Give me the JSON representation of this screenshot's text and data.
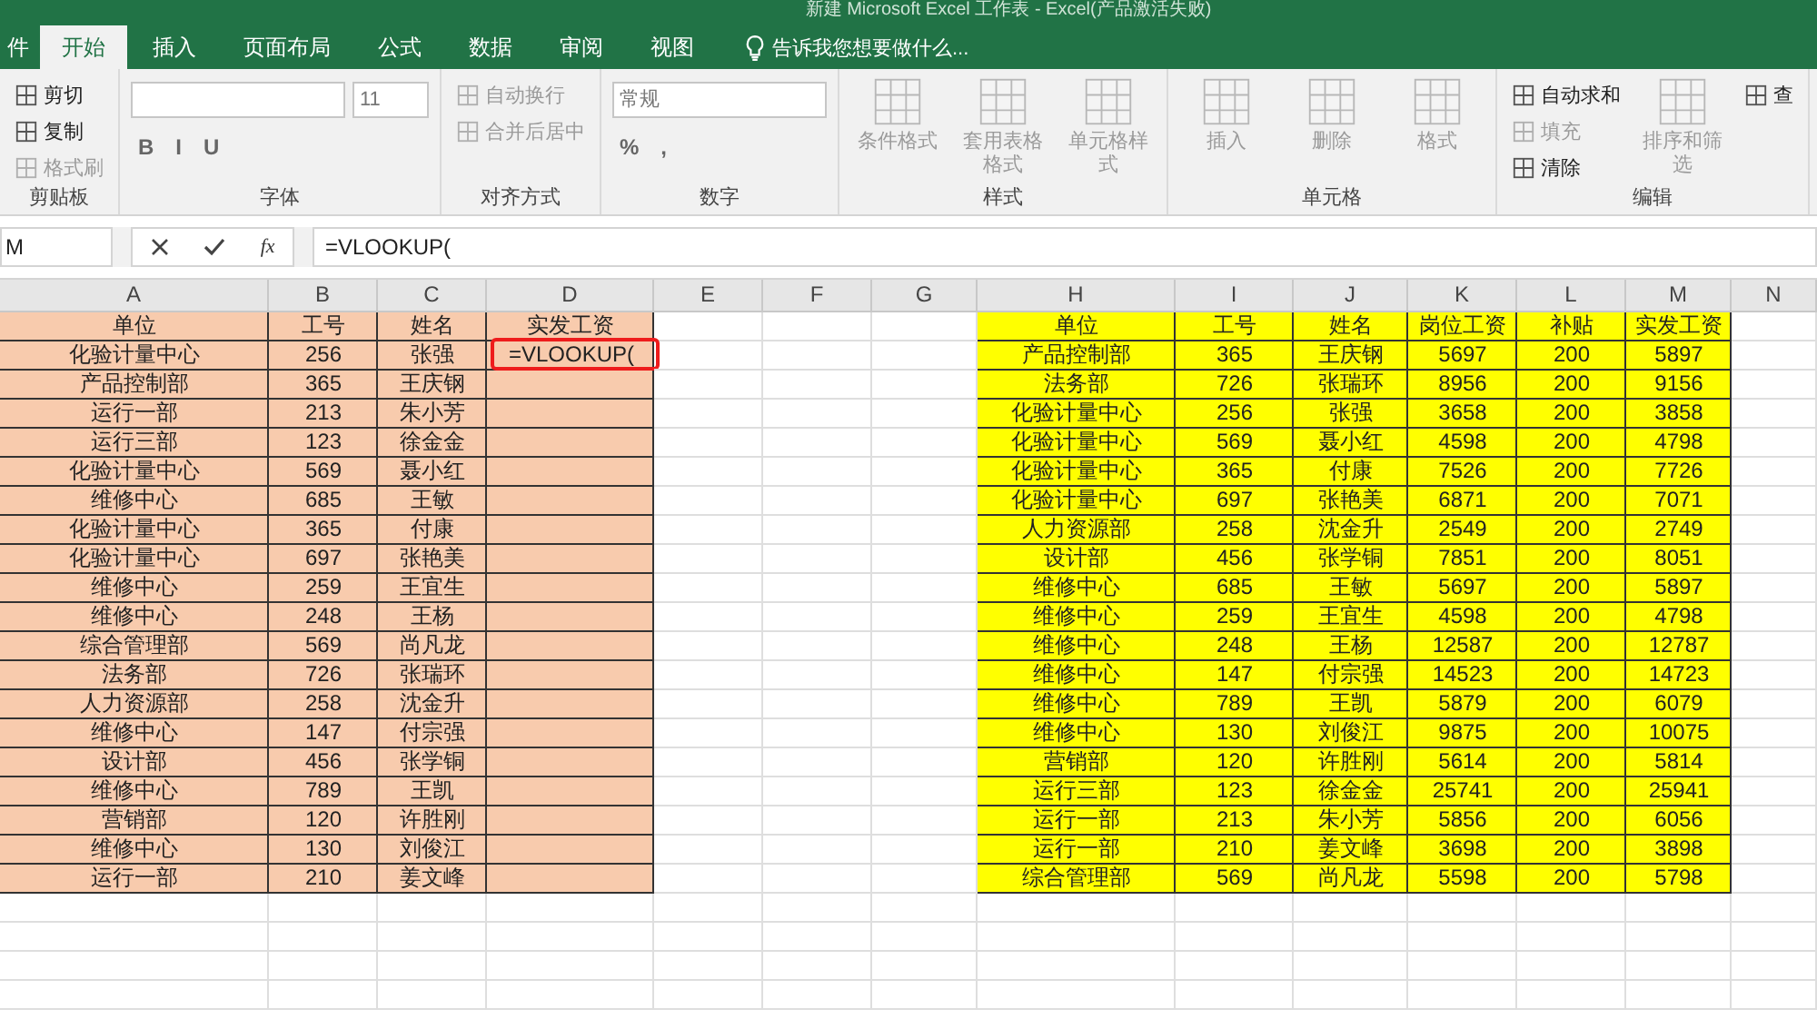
{
  "title_bar": {
    "title": "新建 Microsoft Excel 工作表 - Excel(产品激活失败)"
  },
  "ribbon_tabs": [
    {
      "label": "件",
      "selected": false
    },
    {
      "label": "开始",
      "selected": true
    },
    {
      "label": "插入",
      "selected": false
    },
    {
      "label": "页面布局",
      "selected": false
    },
    {
      "label": "公式",
      "selected": false
    },
    {
      "label": "数据",
      "selected": false
    },
    {
      "label": "审阅",
      "selected": false
    },
    {
      "label": "视图",
      "selected": false
    }
  ],
  "tell_me": "告诉我您想要做什么...",
  "ribbon_groups": [
    {
      "label": "剪贴板",
      "items": [
        {
          "kind": "small",
          "label": "剪切",
          "disabled": false
        },
        {
          "kind": "small",
          "label": "复制",
          "disabled": false
        },
        {
          "kind": "small",
          "label": "格式刷",
          "disabled": true
        }
      ]
    },
    {
      "label": "字体",
      "items": [
        {
          "kind": "field-row",
          "fields": [
            {
              "kind": "wide"
            },
            {
              "kind": "narrow",
              "value": "11"
            }
          ]
        },
        {
          "kind": "toggle-row",
          "labels": [
            "B",
            "I",
            "U"
          ]
        }
      ]
    },
    {
      "label": "对齐方式",
      "items": [
        {
          "kind": "small",
          "label": "自动换行",
          "disabled": true
        },
        {
          "kind": "small",
          "label": "合并后居中",
          "disabled": true
        }
      ]
    },
    {
      "label": "数字",
      "items": [
        {
          "kind": "field-row",
          "fields": [
            {
              "kind": "wide",
              "value": "常规"
            }
          ]
        },
        {
          "kind": "toggle-row",
          "labels": [
            "%",
            ","
          ]
        }
      ]
    },
    {
      "label": "样式",
      "items": [
        {
          "kind": "large",
          "label": "条件格式",
          "disabled": true
        },
        {
          "kind": "large",
          "label": "套用表格格式",
          "disabled": true
        },
        {
          "kind": "large",
          "label": "单元格样式",
          "disabled": true
        }
      ]
    },
    {
      "label": "单元格",
      "items": [
        {
          "kind": "large",
          "label": "插入",
          "disabled": true
        },
        {
          "kind": "large",
          "label": "删除",
          "disabled": true
        },
        {
          "kind": "large",
          "label": "格式",
          "disabled": true
        }
      ]
    },
    {
      "label": "编辑",
      "items": [
        {
          "kind": "small",
          "label": "自动求和",
          "disabled": false
        },
        {
          "kind": "small",
          "label": "填充",
          "disabled": true
        },
        {
          "kind": "small",
          "label": "清除",
          "disabled": false
        },
        {
          "kind": "large",
          "label": "排序和筛选",
          "disabled": true
        },
        {
          "kind": "small",
          "label": "查",
          "disabled": false
        }
      ]
    }
  ],
  "name_box": "M",
  "fx_label": "fx",
  "formula": "=VLOOKUP(",
  "columns": [
    "A",
    "B",
    "C",
    "D",
    "E",
    "F",
    "G",
    "H",
    "I",
    "J",
    "K",
    "L",
    "M",
    "N"
  ],
  "left_table": {
    "header": [
      "单位",
      "工号",
      "姓名",
      "实发工资"
    ],
    "rows": [
      [
        "化验计量中心",
        "256",
        "张强"
      ],
      [
        "产品控制部",
        "365",
        "王庆钢"
      ],
      [
        "运行一部",
        "213",
        "朱小芳"
      ],
      [
        "运行三部",
        "123",
        "徐金金"
      ],
      [
        "化验计量中心",
        "569",
        "聂小红"
      ],
      [
        "维修中心",
        "685",
        "王敏"
      ],
      [
        "化验计量中心",
        "365",
        "付康"
      ],
      [
        "化验计量中心",
        "697",
        "张艳美"
      ],
      [
        "维修中心",
        "259",
        "王宜生"
      ],
      [
        "维修中心",
        "248",
        "王杨"
      ],
      [
        "综合管理部",
        "569",
        "尚凡龙"
      ],
      [
        "法务部",
        "726",
        "张瑞环"
      ],
      [
        "人力资源部",
        "258",
        "沈金升"
      ],
      [
        "维修中心",
        "147",
        "付宗强"
      ],
      [
        "设计部",
        "456",
        "张学铜"
      ],
      [
        "维修中心",
        "789",
        "王凯"
      ],
      [
        "营销部",
        "120",
        "许胜刚"
      ],
      [
        "维修中心",
        "130",
        "刘俊江"
      ],
      [
        "运行一部",
        "210",
        "姜文峰"
      ]
    ],
    "active_cell": {
      "text": "=VLOOKUP("
    }
  },
  "right_table": {
    "header": [
      "单位",
      "工号",
      "姓名",
      "岗位工资",
      "补贴",
      "实发工资"
    ],
    "rows": [
      [
        "产品控制部",
        "365",
        "王庆钢",
        "5697",
        "200",
        "5897"
      ],
      [
        "法务部",
        "726",
        "张瑞环",
        "8956",
        "200",
        "9156"
      ],
      [
        "化验计量中心",
        "256",
        "张强",
        "3658",
        "200",
        "3858"
      ],
      [
        "化验计量中心",
        "569",
        "聂小红",
        "4598",
        "200",
        "4798"
      ],
      [
        "化验计量中心",
        "365",
        "付康",
        "7526",
        "200",
        "7726"
      ],
      [
        "化验计量中心",
        "697",
        "张艳美",
        "6871",
        "200",
        "7071"
      ],
      [
        "人力资源部",
        "258",
        "沈金升",
        "2549",
        "200",
        "2749"
      ],
      [
        "设计部",
        "456",
        "张学铜",
        "7851",
        "200",
        "8051"
      ],
      [
        "维修中心",
        "685",
        "王敏",
        "5697",
        "200",
        "5897"
      ],
      [
        "维修中心",
        "259",
        "王宜生",
        "4598",
        "200",
        "4798"
      ],
      [
        "维修中心",
        "248",
        "王杨",
        "12587",
        "200",
        "12787"
      ],
      [
        "维修中心",
        "147",
        "付宗强",
        "14523",
        "200",
        "14723"
      ],
      [
        "维修中心",
        "789",
        "王凯",
        "5879",
        "200",
        "6079"
      ],
      [
        "维修中心",
        "130",
        "刘俊江",
        "9875",
        "200",
        "10075"
      ],
      [
        "营销部",
        "120",
        "许胜刚",
        "5614",
        "200",
        "5814"
      ],
      [
        "运行三部",
        "123",
        "徐金金",
        "25741",
        "200",
        "25941"
      ],
      [
        "运行一部",
        "213",
        "朱小芳",
        "5856",
        "200",
        "6056"
      ],
      [
        "运行一部",
        "210",
        "姜文峰",
        "3698",
        "200",
        "3898"
      ],
      [
        "综合管理部",
        "569",
        "尚凡龙",
        "5598",
        "200",
        "5798"
      ]
    ]
  }
}
